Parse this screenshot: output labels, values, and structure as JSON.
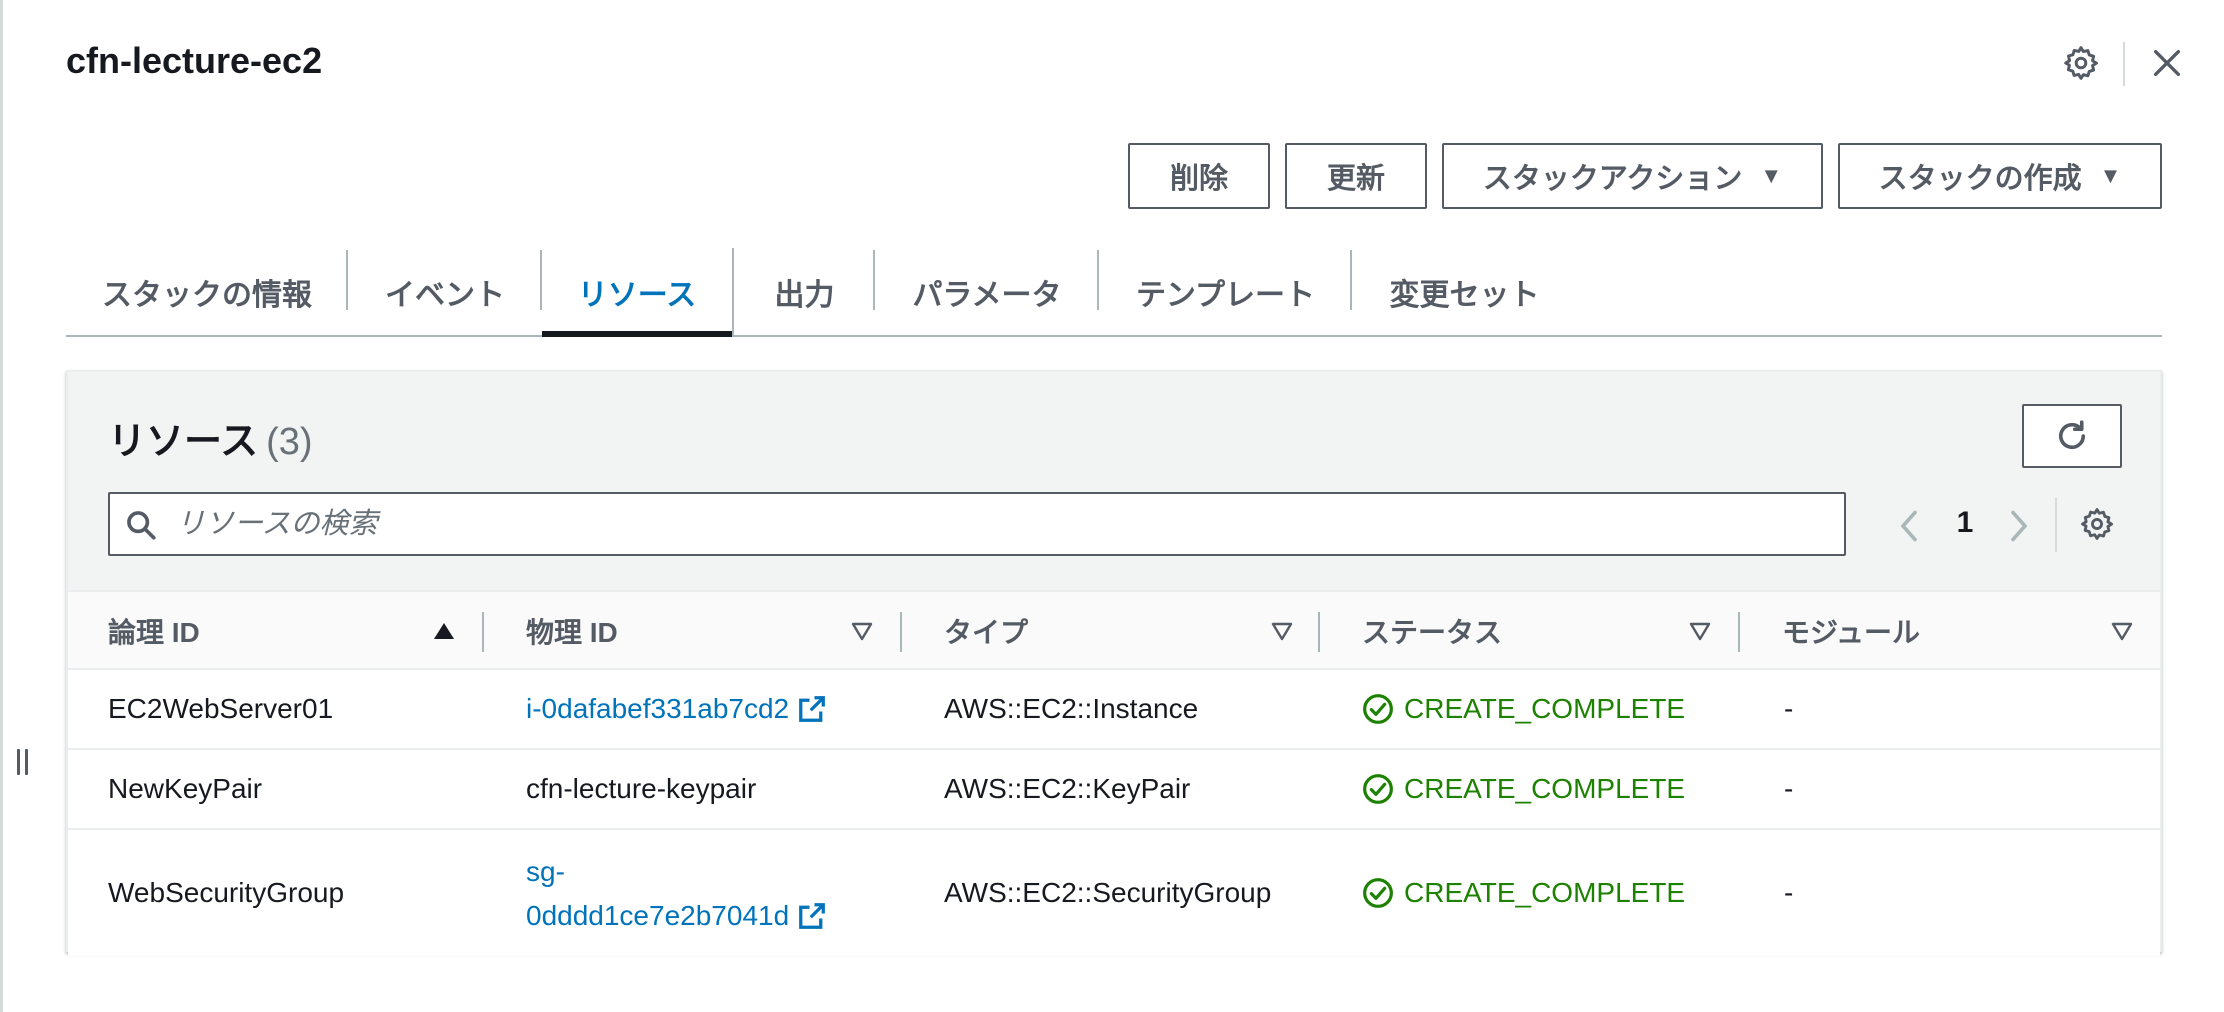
{
  "stack_name": "cfn-lecture-ec2",
  "header": {
    "settings_icon": "gear-icon",
    "close_icon": "close-icon"
  },
  "actions": {
    "delete": "削除",
    "update": "更新",
    "stack_actions": "スタックアクション",
    "create_stack": "スタックの作成",
    "caret": "▼"
  },
  "tabs": [
    {
      "label": "スタックの情報",
      "active": false
    },
    {
      "label": "イベント",
      "active": false
    },
    {
      "label": "リソース",
      "active": true
    },
    {
      "label": "出力",
      "active": false
    },
    {
      "label": "パラメータ",
      "active": false
    },
    {
      "label": "テンプレート",
      "active": false
    },
    {
      "label": "変更セット",
      "active": false
    }
  ],
  "resources": {
    "title": "リソース",
    "count": "(3)",
    "search_placeholder": "リソースの検索",
    "page": "1",
    "columns": [
      "論理 ID",
      "物理 ID",
      "タイプ",
      "ステータス",
      "モジュール"
    ],
    "sorted_column": "論理 ID",
    "rows": [
      {
        "logical_id": "EC2WebServer01",
        "physical_id": "i-0dafabef331ab7cd2",
        "physical_link": true,
        "type": "AWS::EC2::Instance",
        "status": "CREATE_COMPLETE",
        "module": "-"
      },
      {
        "logical_id": "NewKeyPair",
        "physical_id": "cfn-lecture-keypair",
        "physical_link": false,
        "type": "AWS::EC2::KeyPair",
        "status": "CREATE_COMPLETE",
        "module": "-"
      },
      {
        "logical_id": "WebSecurityGroup",
        "physical_id_line1": "sg-",
        "physical_id_line2": "0dddd1ce7e2b7041d",
        "physical_link": true,
        "type": "AWS::EC2::SecurityGroup",
        "status": "CREATE_COMPLETE",
        "module": "-"
      }
    ]
  },
  "colors": {
    "link": "#0073bb",
    "success": "#1d8102",
    "text": "#16191f",
    "muted": "#545b64"
  }
}
